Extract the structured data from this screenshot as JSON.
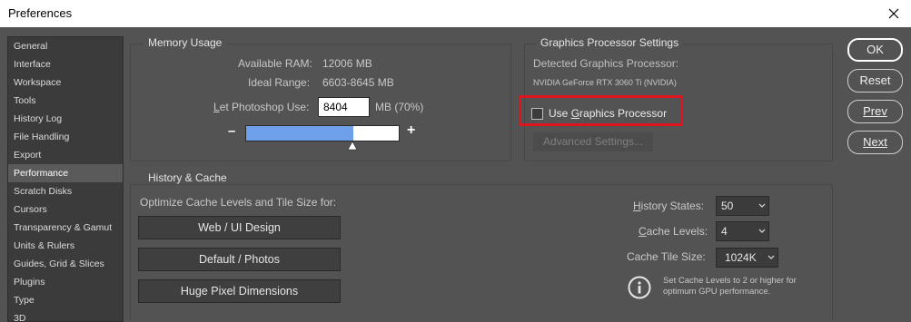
{
  "window": {
    "title": "Preferences"
  },
  "sidebar": {
    "items": [
      {
        "label": "General",
        "active": false
      },
      {
        "label": "Interface",
        "active": false
      },
      {
        "label": "Workspace",
        "active": false
      },
      {
        "label": "Tools",
        "active": false
      },
      {
        "label": "History Log",
        "active": false
      },
      {
        "label": "File Handling",
        "active": false
      },
      {
        "label": "Export",
        "active": false
      },
      {
        "label": "Performance",
        "active": true
      },
      {
        "label": "Scratch Disks",
        "active": false
      },
      {
        "label": "Cursors",
        "active": false
      },
      {
        "label": "Transparency & Gamut",
        "active": false
      },
      {
        "label": "Units & Rulers",
        "active": false
      },
      {
        "label": "Guides, Grid & Slices",
        "active": false
      },
      {
        "label": "Plugins",
        "active": false
      },
      {
        "label": "Type",
        "active": false
      },
      {
        "label": "3D",
        "active": false
      }
    ]
  },
  "memory": {
    "title": "Memory Usage",
    "available_label": "Available RAM:",
    "available_value": "12006 MB",
    "ideal_label": "Ideal Range:",
    "ideal_value": "6603-8645 MB",
    "let_label": "Let Photoshop Use:",
    "let_value": "8404",
    "unit_label": "MB (70%)",
    "minus": "–",
    "plus": "+",
    "slider_fraction": 0.7
  },
  "gpu": {
    "title": "Graphics Processor Settings",
    "detected_label": "Detected Graphics Processor:",
    "gpu_name": "NVIDIA GeForce RTX 3060 Ti (NVIDIA)",
    "use_label": "Use Graphics Processor",
    "use_checked": false,
    "advanced_label": "Advanced Settings...",
    "highlight_color": "#e0141e"
  },
  "history": {
    "title": "History & Cache",
    "optimize_label": "Optimize Cache Levels and Tile Size for:",
    "buttons": [
      "Web / UI Design",
      "Default / Photos",
      "Huge Pixel Dimensions"
    ],
    "states_label": "History States:",
    "states_value": "50",
    "levels_label": "Cache Levels:",
    "levels_value": "4",
    "tile_label": "Cache Tile Size:",
    "tile_value": "1024K",
    "info_text_line1": "Set Cache Levels to 2 or higher for",
    "info_text_line2": "optimum GPU performance."
  },
  "actions": {
    "ok": "OK",
    "reset": "Reset",
    "prev": "Prev",
    "next": "Next"
  }
}
